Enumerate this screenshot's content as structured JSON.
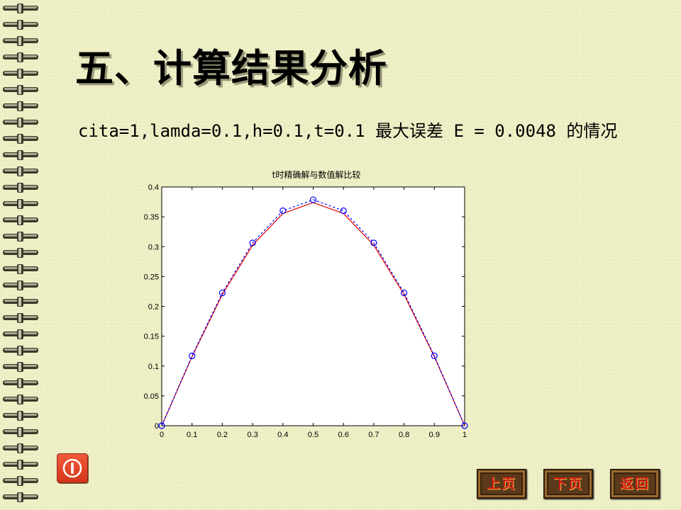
{
  "slide": {
    "title": "五、计算结果分析",
    "description": "cita=1,lamda=0.1,h=0.1,t=0.1 最大误差 E = 0.0048 的情况"
  },
  "nav": {
    "prev_label": "上页",
    "next_label": "下页",
    "back_label": "返回"
  },
  "icons": {
    "power": "power-icon"
  },
  "colors": {
    "background": "#efefc6",
    "exact_line": "#e00000",
    "numeric_line": "#0000ff",
    "nav_text": "#d01818",
    "power_button": "#e04828"
  },
  "chart_data": {
    "type": "line",
    "title": "t时精确解与数值解比较",
    "xlabel": "",
    "ylabel": "",
    "xlim": [
      0,
      1
    ],
    "ylim": [
      0,
      0.4
    ],
    "xticks": [
      "0",
      "0.1",
      "0.2",
      "0.3",
      "0.4",
      "0.5",
      "0.6",
      "0.7",
      "0.8",
      "0.9",
      "1"
    ],
    "yticks": [
      "0",
      "0.05",
      "0.1",
      "0.15",
      "0.2",
      "0.25",
      "0.3",
      "0.35",
      "0.4"
    ],
    "grid": false,
    "x": [
      0,
      0.1,
      0.2,
      0.3,
      0.4,
      0.5,
      0.6,
      0.7,
      0.8,
      0.9,
      1.0
    ],
    "series": [
      {
        "style": "red solid line",
        "values": [
          0,
          0.1156,
          0.2198,
          0.3025,
          0.3556,
          0.3739,
          0.3556,
          0.3025,
          0.2198,
          0.1156,
          0
        ]
      },
      {
        "style": "blue dashed line with circle markers",
        "values": [
          0,
          0.1171,
          0.2226,
          0.3064,
          0.3602,
          0.3787,
          0.3602,
          0.3064,
          0.2226,
          0.1171,
          0
        ]
      }
    ]
  }
}
